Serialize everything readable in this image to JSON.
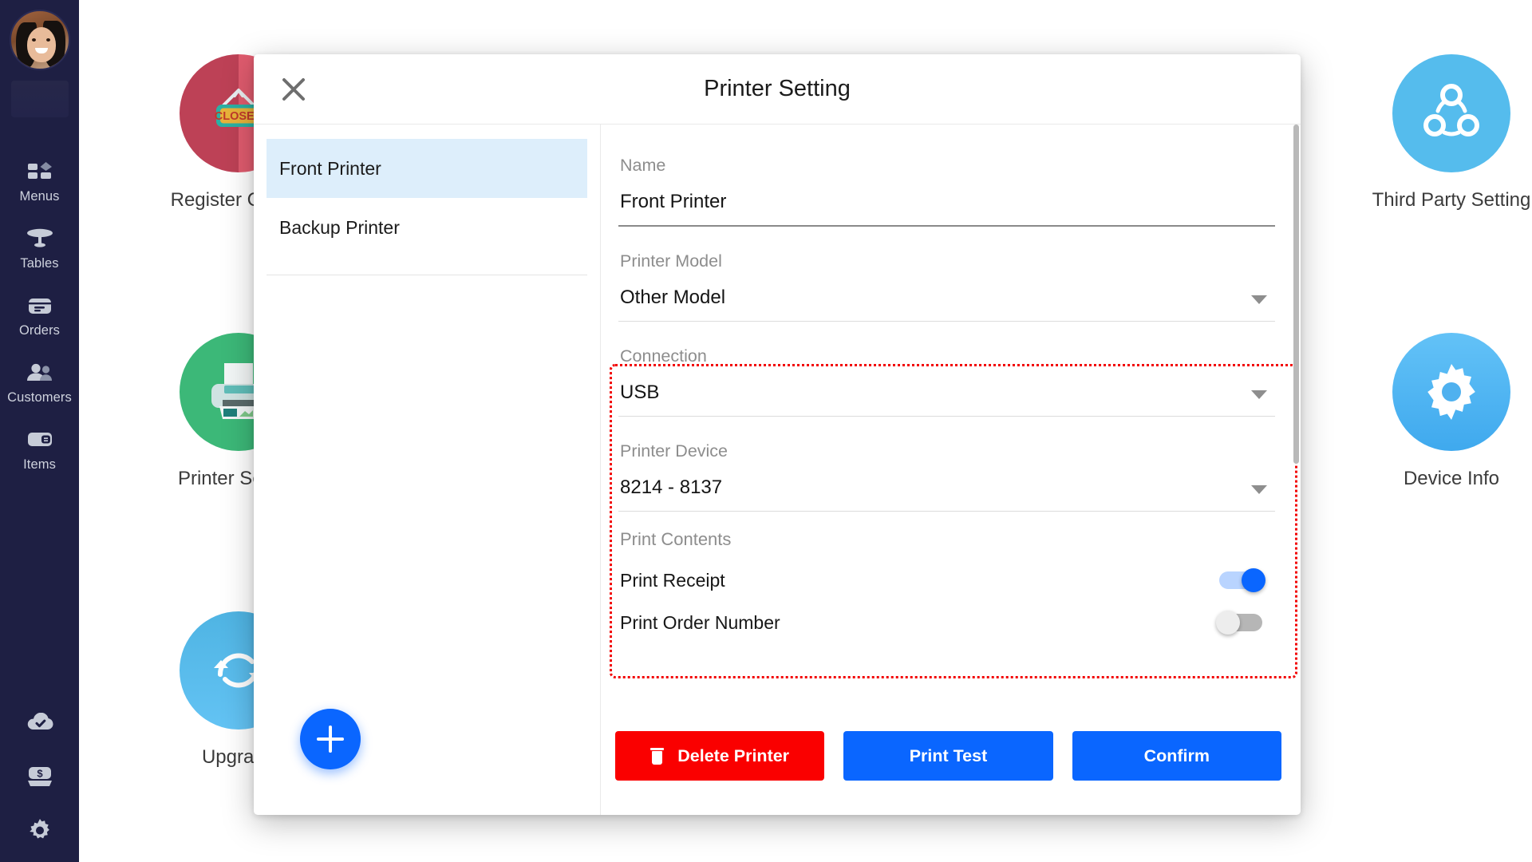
{
  "sidebar": {
    "avatar_name": "user-avatar",
    "items": [
      {
        "label": "Menus",
        "icon": "menus-icon"
      },
      {
        "label": "Tables",
        "icon": "tables-icon"
      },
      {
        "label": "Orders",
        "icon": "orders-icon"
      },
      {
        "label": "Customers",
        "icon": "customers-icon"
      },
      {
        "label": "Items",
        "icon": "items-icon"
      }
    ],
    "bottom_icons": [
      {
        "icon": "cloud-check-icon"
      },
      {
        "icon": "cash-register-icon"
      },
      {
        "icon": "gear-icon"
      }
    ]
  },
  "tiles": [
    {
      "label": "Register Closed",
      "icon": "register-closed-icon",
      "color": "#c8485c",
      "badge_text": "CLOSED"
    },
    {
      "label": "Printer Setting",
      "icon": "printer-icon",
      "color": "#3cb878"
    },
    {
      "label": "Upgrade",
      "icon": "upgrade-icon",
      "color": "#54b6ec"
    },
    {
      "label": "Third Party Setting",
      "icon": "third-party-share-icon",
      "color": "#55bced"
    },
    {
      "label": "Device Info",
      "icon": "gear-icon",
      "color": "#5ec0f5"
    }
  ],
  "dialog": {
    "title": "Printer Setting",
    "close_label": "×",
    "printer_list": [
      {
        "label": "Front Printer",
        "selected": true
      },
      {
        "label": "Backup Printer",
        "selected": false
      }
    ],
    "add_printer_label": "+",
    "fields": [
      {
        "key": "name",
        "label": "Name",
        "value": "Front Printer",
        "type": "text"
      },
      {
        "key": "printer_model",
        "label": "Printer Model",
        "value": "Other Model",
        "type": "select"
      },
      {
        "key": "connection",
        "label": "Connection",
        "value": "USB",
        "type": "select"
      },
      {
        "key": "printer_device",
        "label": "Printer Device",
        "value": "8214 - 8137",
        "type": "select"
      }
    ],
    "print_contents": {
      "section_label": "Print Contents",
      "toggles": [
        {
          "label": "Print Receipt",
          "state": "on"
        },
        {
          "label": "Print Order Number",
          "state": "off"
        }
      ]
    },
    "buttons": [
      {
        "label": "Delete Printer",
        "style": "red",
        "icon": "trash-icon"
      },
      {
        "label": "Print Test",
        "style": "blue",
        "icon": ""
      },
      {
        "label": "Confirm",
        "style": "blue",
        "icon": ""
      }
    ],
    "highlight_color": "#f20000"
  }
}
